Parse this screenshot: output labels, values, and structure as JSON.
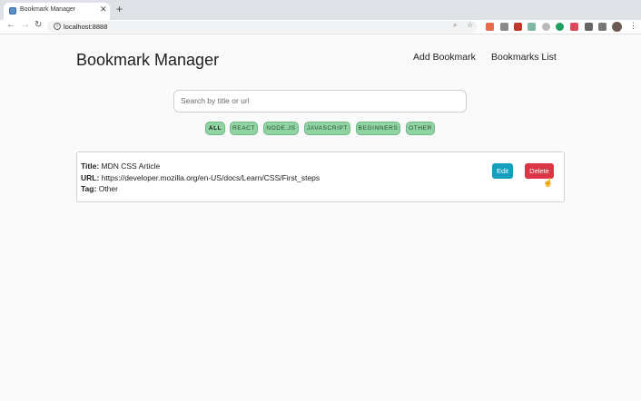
{
  "browser": {
    "tab_title": "Bookmark Manager",
    "tab_close": "✕",
    "new_tab": "+",
    "url": "localhost:8888",
    "back": "←",
    "forward": "→",
    "reload": "↻",
    "more": "⋮"
  },
  "header": {
    "title": "Bookmark Manager",
    "links": [
      "Add Bookmark",
      "Bookmarks List"
    ]
  },
  "search": {
    "placeholder": "Search by title or url",
    "value": ""
  },
  "filters": {
    "active": "ALL",
    "tags": [
      "ALL",
      "REACT",
      "NODE.JS",
      "JAVASCRIPT",
      "BEGINNERS",
      "OTHER"
    ]
  },
  "bookmarks": [
    {
      "title_label": "Title:",
      "title": "MDN CSS Article",
      "url_label": "URL:",
      "url": "https://developer.mozilla.org/en-US/docs/Learn/CSS/First_steps",
      "tag_label": "Tag:",
      "tag": "Other",
      "edit_label": "Edit",
      "delete_label": "Delete"
    }
  ],
  "colors": {
    "chip_bg": "#8fd4a2",
    "edit_button": "#149fbf",
    "delete_button": "#dc3545"
  },
  "icons": {
    "favicon": "app-favicon",
    "zoom": "zoom-icon",
    "star": "star-icon",
    "extensions": "puzzle-icon",
    "cursor": "hand-pointer-icon"
  }
}
